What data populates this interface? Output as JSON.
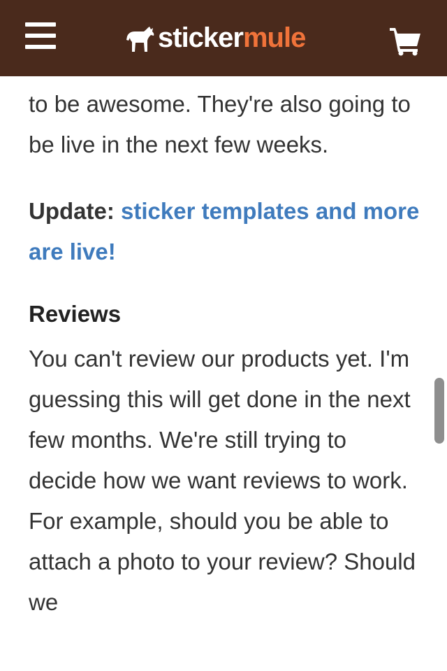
{
  "header": {
    "logo": {
      "word_primary": "sticker",
      "word_accent": "mule",
      "icon": "mule-icon"
    },
    "menu_icon": "hamburger-menu-icon",
    "cart_icon": "shopping-cart-icon",
    "colors": {
      "background": "#4a2a1c",
      "logo_accent": "#f0733a",
      "foreground": "#ffffff"
    }
  },
  "article": {
    "paragraph_top": "to be awesome. They're also going to be live in the next few weeks.",
    "update_label": "Update:",
    "update_link_text": "sticker templates and more are live!",
    "reviews_heading": "Reviews",
    "reviews_paragraph": "You can't review our products yet. I'm guessing this will get done in the next few months. We're still trying to decide how we want reviews to work. For example, should you be able to attach a photo to your review? Should we",
    "colors": {
      "text": "#333333",
      "link": "#3f7bbd"
    }
  }
}
